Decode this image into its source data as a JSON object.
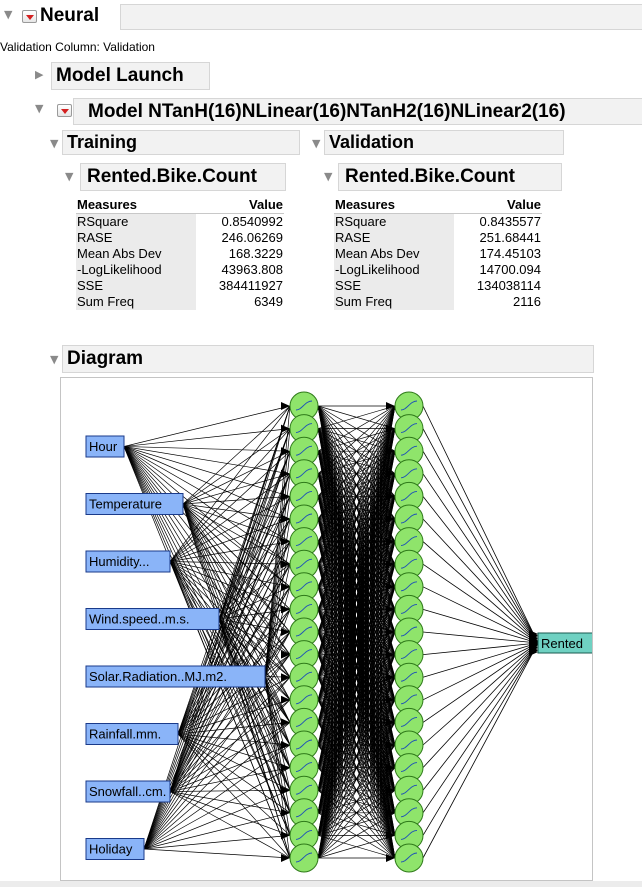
{
  "neural": {
    "title": "Neural",
    "validation_note": "Validation Column: Validation",
    "model_launch": "Model Launch",
    "model_title": "Model NTanH(16)NLinear(16)NTanH2(16)NLinear2(16)",
    "training": {
      "section_title": "Training",
      "response_title": "Rented.Bike.Count",
      "col_measure": "Measures",
      "col_value": "Value",
      "rows": [
        {
          "measure": "RSquare",
          "value": "0.8540992"
        },
        {
          "measure": "RASE",
          "value": "246.06269"
        },
        {
          "measure": "Mean Abs Dev",
          "value": "168.3229"
        },
        {
          "measure": "-LogLikelihood",
          "value": "43963.808"
        },
        {
          "measure": "SSE",
          "value": "384411927"
        },
        {
          "measure": "Sum Freq",
          "value": "6349"
        }
      ]
    },
    "validation": {
      "section_title": "Validation",
      "response_title": "Rented.Bike.Count",
      "col_measure": "Measures",
      "col_value": "Value",
      "rows": [
        {
          "measure": "RSquare",
          "value": "0.8435577"
        },
        {
          "measure": "RASE",
          "value": "251.68441"
        },
        {
          "measure": "Mean Abs Dev",
          "value": "174.45103"
        },
        {
          "measure": "-LogLikelihood",
          "value": "14700.094"
        },
        {
          "measure": "SSE",
          "value": "134038114"
        },
        {
          "measure": "Sum Freq",
          "value": "2116"
        }
      ]
    },
    "diagram": {
      "section_title": "Diagram",
      "inputs": [
        "Hour",
        "Temperature",
        "Humidity...",
        "Wind.speed..m.s.",
        "Solar.Radiation..MJ.m2.",
        "Rainfall.mm.",
        "Snowfall..cm.",
        "Holiday"
      ],
      "output": "Rented",
      "layer1_visible_nodes": 21,
      "layer2_visible_nodes": 21,
      "colors": {
        "input_fill": "#8ab4f8",
        "node_fill": "#8fe46b",
        "output_fill": "#6fd1c2"
      }
    }
  }
}
